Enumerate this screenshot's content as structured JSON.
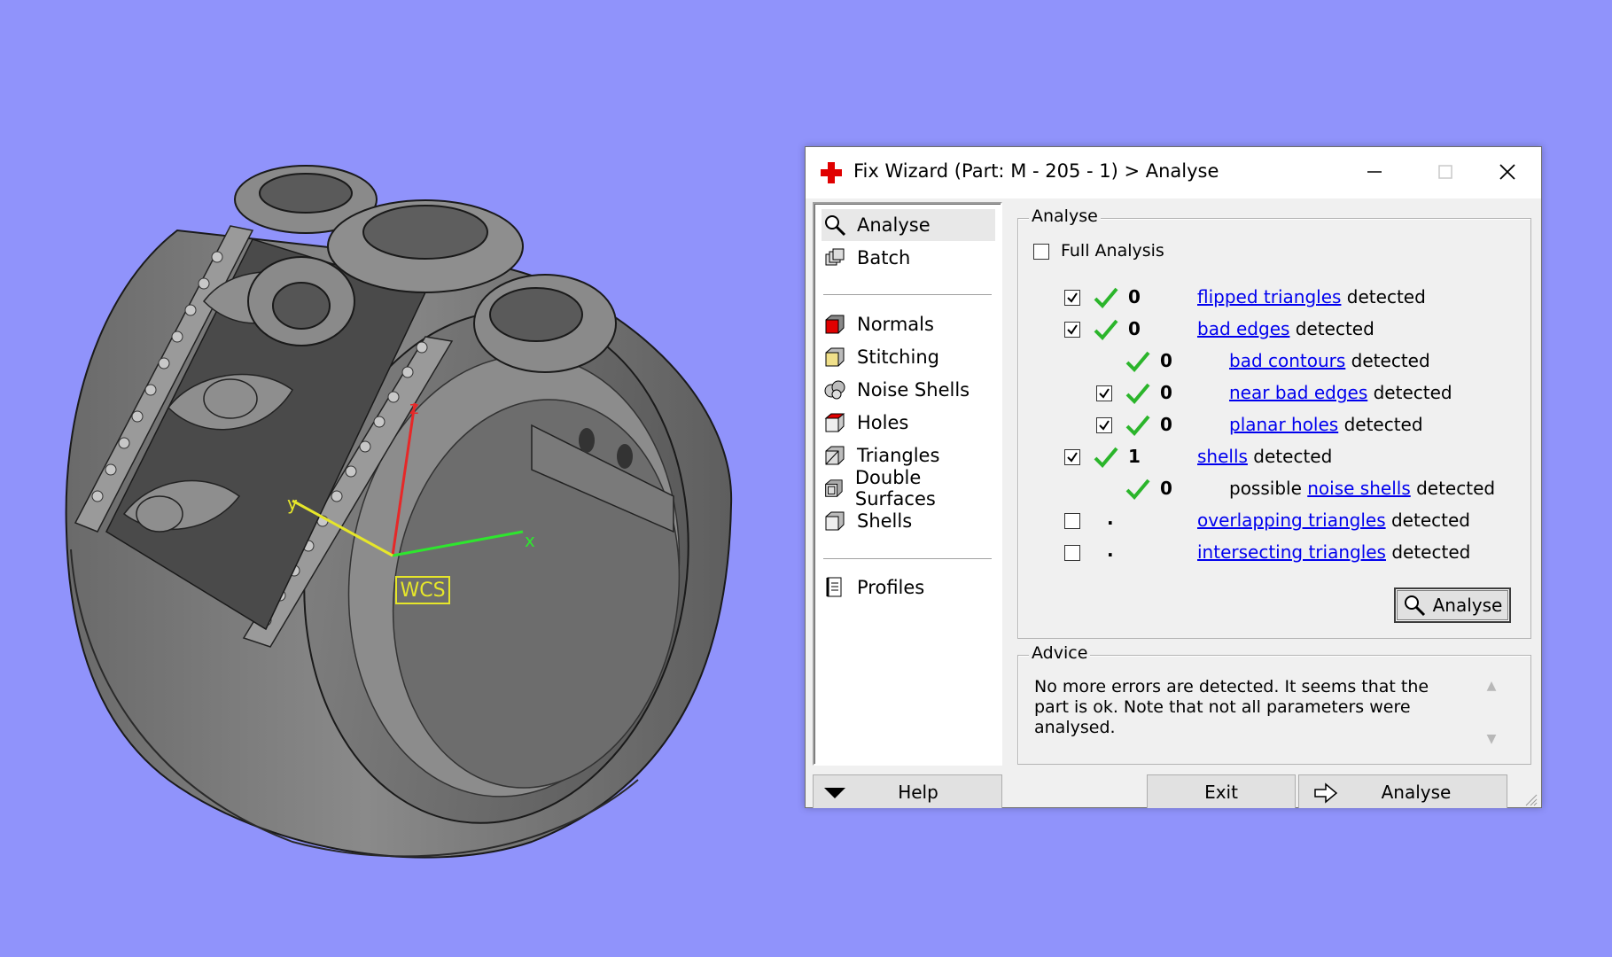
{
  "viewport": {
    "axis_x": "x",
    "axis_y": "y",
    "axis_z": "z",
    "wcs_label": "WCS",
    "axis_colors": {
      "x": "#2ee62e",
      "y": "#e6e62a",
      "z": "#e62828"
    },
    "model_color": "#7a7a7a",
    "background": "#9093fb"
  },
  "dialog": {
    "title": "Fix Wizard (Part: M - 205 - 1) > Analyse",
    "title_icon": "red-cross-icon",
    "window_buttons": {
      "minimize": "–",
      "maximize": "□",
      "close": "✕"
    },
    "nav": {
      "items_top": [
        {
          "label": "Analyse",
          "icon": "magnifier-icon",
          "selected": true
        },
        {
          "label": "Batch",
          "icon": "batch-icon"
        }
      ],
      "items_mid": [
        {
          "label": "Normals",
          "icon": "normals-cube-icon"
        },
        {
          "label": "Stitching",
          "icon": "stitching-cube-icon"
        },
        {
          "label": "Noise Shells",
          "icon": "noise-shells-icon"
        },
        {
          "label": "Holes",
          "icon": "holes-cube-icon"
        },
        {
          "label": "Triangles",
          "icon": "triangles-cube-icon"
        },
        {
          "label": "Double Surfaces",
          "icon": "double-surfaces-icon"
        },
        {
          "label": "Shells",
          "icon": "shells-cube-icon"
        }
      ],
      "items_bottom": [
        {
          "label": "Profiles",
          "icon": "profiles-icon"
        }
      ]
    },
    "analyse_group": {
      "title": "Analyse",
      "full_analysis_label": "Full Analysis",
      "full_analysis_checked": false,
      "rows": [
        {
          "checkbox": true,
          "checked": true,
          "ok": true,
          "count": "0",
          "prefix": "",
          "link": "flipped triangles",
          "suffix": " detected",
          "indent": 0
        },
        {
          "checkbox": true,
          "checked": true,
          "ok": true,
          "count": "0",
          "prefix": "",
          "link": "bad edges",
          "suffix": " detected",
          "indent": 0
        },
        {
          "checkbox": false,
          "checked": false,
          "ok": true,
          "count": "0",
          "prefix": "",
          "link": "bad contours",
          "suffix": " detected",
          "indent": 1
        },
        {
          "checkbox": true,
          "checked": true,
          "ok": true,
          "count": "0",
          "prefix": "",
          "link": "near bad edges",
          "suffix": " detected",
          "indent": 1
        },
        {
          "checkbox": true,
          "checked": true,
          "ok": true,
          "count": "0",
          "prefix": "",
          "link": "planar holes",
          "suffix": " detected",
          "indent": 1
        },
        {
          "checkbox": true,
          "checked": true,
          "ok": true,
          "count": "1",
          "prefix": "",
          "link": "shells",
          "suffix": " detected",
          "indent": 0
        },
        {
          "checkbox": false,
          "checked": false,
          "ok": true,
          "count": "0",
          "prefix": "possible ",
          "link": "noise shells",
          "suffix": " detected",
          "indent": 1
        },
        {
          "checkbox": true,
          "checked": false,
          "ok": false,
          "count": ".",
          "prefix": "",
          "link": "overlapping triangles",
          "suffix": " detected",
          "indent": 0
        },
        {
          "checkbox": true,
          "checked": false,
          "ok": false,
          "count": ".",
          "prefix": "",
          "link": "intersecting triangles",
          "suffix": " detected",
          "indent": 0
        }
      ],
      "analyse_button": "Analyse"
    },
    "advice_group": {
      "title": "Advice",
      "text": "No more errors are detected. It seems that the part is ok. Note that not all parameters were analysed."
    },
    "bottom_bar": {
      "help_label": "Help",
      "exit_label": "Exit",
      "next_label": "Analyse"
    },
    "colors": {
      "link": "#0000ee",
      "check_green": "#2bb52b",
      "normals_red": "#e00000"
    }
  }
}
